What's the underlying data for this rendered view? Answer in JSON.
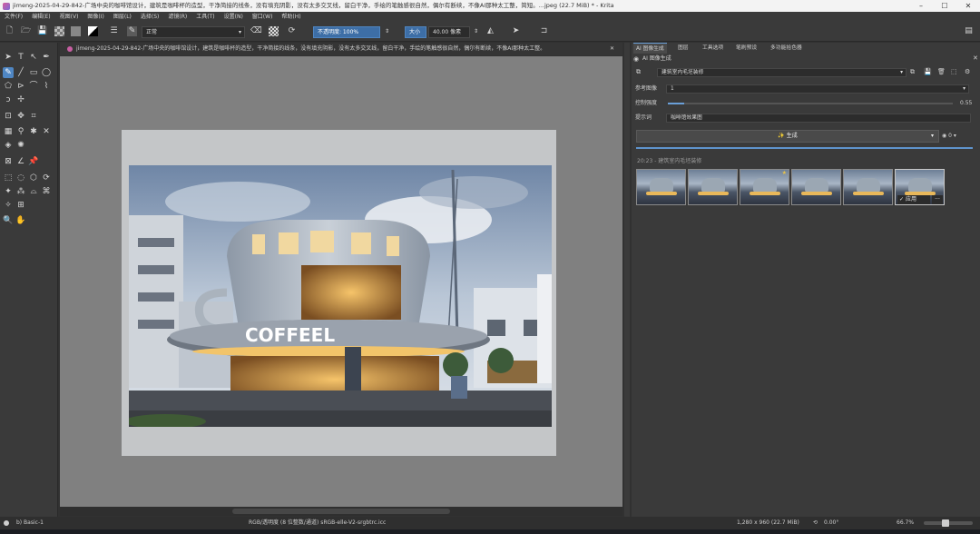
{
  "window": {
    "title": "jimeng-2025-04-29-842-广场中央的咖啡馆设计，建筑是咖啡杯的造型，干净简接的线条，没有填充阴影，没有太多交叉线，留白干净，手绘的笔触感很自然，偶尔有断续，不像AI那种太工整，简短。...jpeg (22.7 MiB) * - Krita",
    "controls": [
      "–",
      "☐",
      "✕"
    ]
  },
  "menu": [
    "文件(F)",
    "编辑(E)",
    "视图(V)",
    "图像(I)",
    "图层(L)",
    "选择(S)",
    "滤镜(R)",
    "工具(T)",
    "设置(N)",
    "窗口(W)",
    "帮助(H)"
  ],
  "toolbar": {
    "blend_mode": "正常",
    "opacity": "不透明度: 100%",
    "size_label": "大小",
    "size_value": "40.00 像素"
  },
  "document": {
    "tab_title": "jimeng-2025-04-29-842-广场中央的咖啡馆设计，建筑是咖啡杯的造型，干净简接的线条，没有填充阴影，没有太多交叉线，留白干净，手绘的笔触感很自然，偶尔有断续，不像AI那种太工整。",
    "sign_text": "COFFEEL"
  },
  "right_panel": {
    "tabs": [
      "AI 图像生成",
      "图层",
      "工具选项",
      "笔刷预设",
      "多功能拾色器"
    ],
    "section_title": "AI 图像生成",
    "workspace_value": "建筑室内毛坯装修",
    "ref_image_label": "参考图像",
    "ref_image_value": "1",
    "control_strength_label": "控制强度",
    "control_strength_value": "0.55",
    "prompt_label": "提示词",
    "prompt_value": "咖啡馆效果图",
    "generate_label": "生成",
    "seed_value": "0",
    "history_label": "20:23 - 建筑室内毛坯装修",
    "apply_label": "应用",
    "more_label": "···"
  },
  "status": {
    "brush_preset": "b) Basic-1",
    "color_info": "RGB/透明度 (8 位整数/通道)  sRGB-elle-V2-srgbtrc.icc",
    "image_size": "1,280 x 960 (22.7 MiB)",
    "rotation": "0.00°",
    "zoom": "66.7%"
  },
  "colors": {
    "accent": "#4f86c3",
    "panel_bg": "#3a3a3a",
    "canvas_bg": "#808080"
  }
}
